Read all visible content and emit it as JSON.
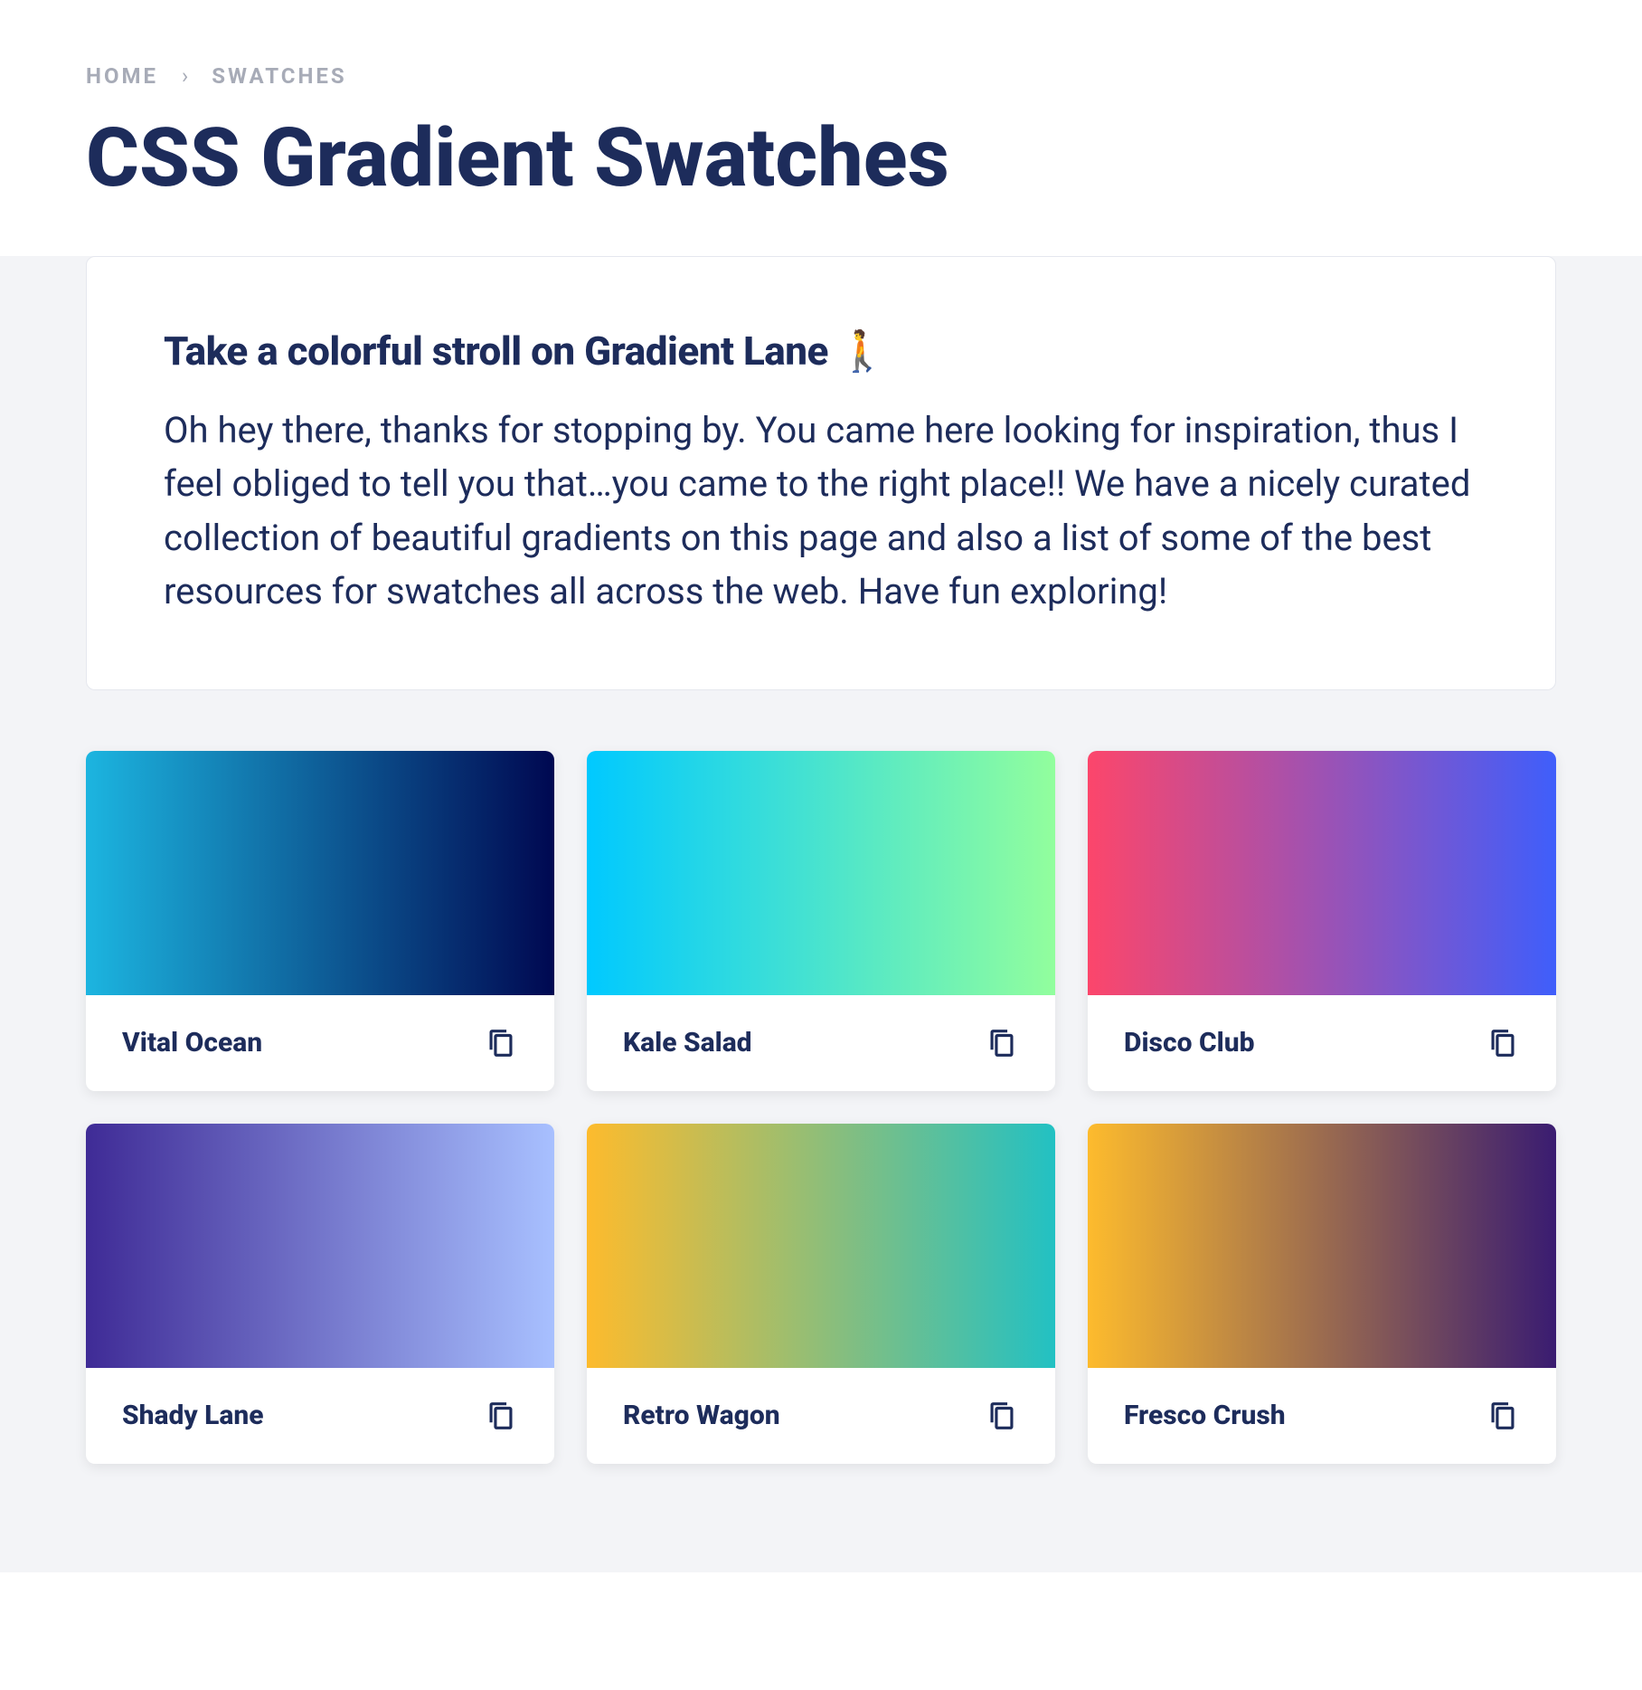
{
  "breadcrumb": {
    "home": "HOME",
    "separator": "›",
    "current": "SWATCHES"
  },
  "title": "CSS Gradient Swatches",
  "intro": {
    "heading": "Take a colorful stroll on Gradient Lane 🚶",
    "body": "Oh hey there, thanks for stopping by. You came here looking for inspiration, thus I feel obliged to tell you that…you came to the right place!! We have a nicely curated collection of beautiful gradients on this page and also a list of some of the best resources for swatches all across the web. Have fun exploring!"
  },
  "swatches": [
    {
      "name": "Vital Ocean",
      "gradient": "linear-gradient(90deg, #1cb5e0 0%, #000851 100%)"
    },
    {
      "name": "Kale Salad",
      "gradient": "linear-gradient(90deg, #00c9ff 0%, #92fe9d 100%)"
    },
    {
      "name": "Disco Club",
      "gradient": "linear-gradient(90deg, #fc466b 0%, #3f5efb 100%)"
    },
    {
      "name": "Shady Lane",
      "gradient": "linear-gradient(90deg, #3f2b96 0%, #a8c0ff 100%)"
    },
    {
      "name": "Retro Wagon",
      "gradient": "linear-gradient(90deg, #fdbb2d 0%, #22c1c3 100%)"
    },
    {
      "name": "Fresco Crush",
      "gradient": "linear-gradient(90deg, #fdbb2d 0%, #3a1c71 100%)"
    }
  ]
}
